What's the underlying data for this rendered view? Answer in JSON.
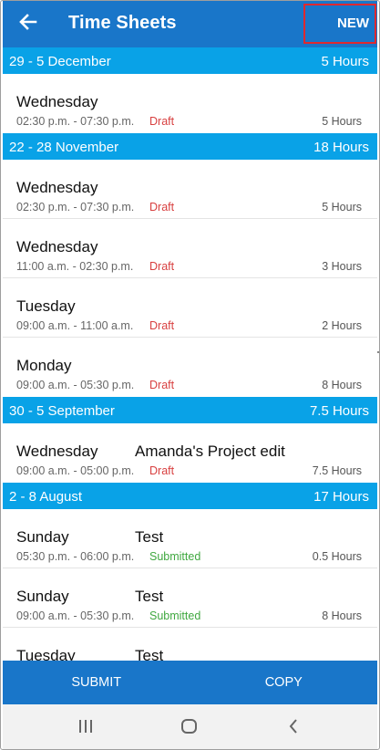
{
  "app": {
    "title": "Time Sheets",
    "new_label": "NEW",
    "back_icon": "arrow-left-icon",
    "accent_color": "#1976c9",
    "header_color": "#09a2e7"
  },
  "groups": [
    {
      "range": "29 - 5 December",
      "total": "5 Hours",
      "entries": [
        {
          "day": "Wednesday",
          "project": "",
          "time": "02:30 p.m. - 07:30 p.m.",
          "status": "Draft",
          "hours": "5 Hours"
        }
      ]
    },
    {
      "range": "22 - 28 November",
      "total": "18 Hours",
      "entries": [
        {
          "day": "Wednesday",
          "project": "",
          "time": "02:30 p.m. - 07:30 p.m.",
          "status": "Draft",
          "hours": "5 Hours"
        },
        {
          "day": "Wednesday",
          "project": "",
          "time": "11:00 a.m. - 02:30 p.m.",
          "status": "Draft",
          "hours": "3 Hours"
        },
        {
          "day": "Tuesday",
          "project": "",
          "time": "09:00 a.m. - 11:00 a.m.",
          "status": "Draft",
          "hours": "2 Hours"
        },
        {
          "day": "Monday",
          "project": "",
          "time": "09:00 a.m. - 05:30 p.m.",
          "status": "Draft",
          "hours": "8 Hours"
        }
      ]
    },
    {
      "range": "30 - 5 September",
      "total": "7.5 Hours",
      "entries": [
        {
          "day": "Wednesday",
          "project": "Amanda's Project edit",
          "time": "09:00 a.m. - 05:00 p.m.",
          "status": "Draft",
          "hours": "7.5 Hours"
        }
      ]
    },
    {
      "range": "2 - 8 August",
      "total": "17 Hours",
      "entries": [
        {
          "day": "Sunday",
          "project": "Test",
          "time": "05:30 p.m. - 06:00 p.m.",
          "status": "Submitted",
          "hours": "0.5 Hours"
        },
        {
          "day": "Sunday",
          "project": "Test",
          "time": "09:00 a.m. - 05:30 p.m.",
          "status": "Submitted",
          "hours": "8 Hours"
        },
        {
          "day": "Tuesday",
          "project": "Test",
          "time": "",
          "status": "",
          "hours": ""
        }
      ]
    }
  ],
  "actions": {
    "submit_label": "SUBMIT",
    "copy_label": "COPY"
  },
  "system_nav": {
    "recents_icon": "recents-icon",
    "home_icon": "home-icon",
    "back_icon": "nav-back-icon"
  }
}
